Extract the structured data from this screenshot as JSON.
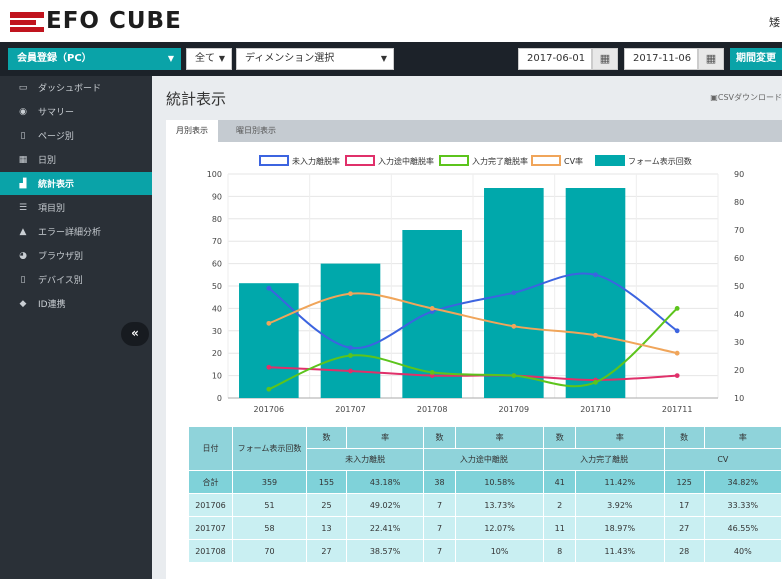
{
  "app": {
    "logo_text": "EFO CUBE",
    "user_mark": "矮"
  },
  "filters": {
    "form_select": "会員登録（PC）",
    "scope_select": "全て",
    "dimension_select": "ディメンション選択",
    "start_date": "2017-06-01",
    "end_date": "2017-11-06",
    "period_button": "期間変更"
  },
  "sidebar": {
    "items": [
      {
        "label": "ダッシュボード",
        "icon": "monitor-icon",
        "glyph": "▭",
        "active": false
      },
      {
        "label": "サマリー",
        "icon": "globe-icon",
        "glyph": "◉",
        "active": false
      },
      {
        "label": "ページ別",
        "icon": "file-icon",
        "glyph": "▯",
        "active": false
      },
      {
        "label": "日別",
        "icon": "calendar-icon",
        "glyph": "▦",
        "active": false
      },
      {
        "label": "統計表示",
        "icon": "bar-chart-icon",
        "glyph": "▟",
        "active": true
      },
      {
        "label": "項目別",
        "icon": "list-icon",
        "glyph": "☰",
        "active": false
      },
      {
        "label": "エラー詳細分析",
        "icon": "warning-icon",
        "glyph": "▲",
        "active": false
      },
      {
        "label": "ブラウザ別",
        "icon": "browser-icon",
        "glyph": "◕",
        "active": false
      },
      {
        "label": "デバイス別",
        "icon": "device-icon",
        "glyph": "▯",
        "active": false
      },
      {
        "label": "ID連携",
        "icon": "tag-icon",
        "glyph": "◆",
        "active": false
      }
    ],
    "collapse_label": "«"
  },
  "main": {
    "title": "統計表示",
    "csv_label": "CSVダウンロード",
    "tabs": [
      {
        "label": "月別表示",
        "active": true
      },
      {
        "label": "曜日別表示",
        "active": false
      }
    ]
  },
  "colors": {
    "accent": "#0aa3a8",
    "bars": "#00a8ab",
    "mi_nyuryoku": "#3c64e0",
    "nyuryoku_tochu": "#e0306a",
    "nyuryoku_kanryo": "#5cc41c",
    "cv": "#f0a55a"
  },
  "chart_data": {
    "type": "bar",
    "categories": [
      "201706",
      "201707",
      "201708",
      "201709",
      "201710",
      "201711"
    ],
    "y_left": {
      "ylim": [
        0,
        100
      ],
      "ticks": [
        0,
        10,
        20,
        30,
        40,
        50,
        60,
        70,
        80,
        90,
        100
      ]
    },
    "y_right": {
      "ylim": [
        10,
        90
      ],
      "ticks": [
        10,
        20,
        30,
        40,
        50,
        60,
        70,
        80,
        90
      ]
    },
    "legend_position": "top",
    "series": [
      {
        "name": "未入力離脱率",
        "type": "line",
        "axis": "left",
        "values": [
          49.02,
          22.41,
          38.57,
          47,
          55,
          30
        ]
      },
      {
        "name": "入力途中離脱率",
        "type": "line",
        "axis": "left",
        "values": [
          13.73,
          12.07,
          10,
          10,
          8,
          10
        ]
      },
      {
        "name": "入力完了離脱率",
        "type": "line",
        "axis": "left",
        "values": [
          3.92,
          18.97,
          11.43,
          10,
          7,
          40
        ]
      },
      {
        "name": "CV率",
        "type": "line",
        "axis": "left",
        "values": [
          33.33,
          46.55,
          40,
          32,
          28,
          20
        ]
      },
      {
        "name": "フォーム表示回数",
        "type": "bar",
        "axis": "right",
        "values": [
          51,
          58,
          70,
          85,
          85,
          null
        ]
      }
    ]
  },
  "table": {
    "header_top": [
      "日付",
      "フォーム表示回数",
      "数",
      "率",
      "数",
      "率",
      "数",
      "率",
      "数",
      "率"
    ],
    "groups": [
      "未入力離脱",
      "入力途中離脱",
      "入力完了離脱",
      "CV"
    ],
    "rows": [
      [
        "合計",
        "359",
        "155",
        "43.18%",
        "38",
        "10.58%",
        "41",
        "11.42%",
        "125",
        "34.82%"
      ],
      [
        "201706",
        "51",
        "25",
        "49.02%",
        "7",
        "13.73%",
        "2",
        "3.92%",
        "17",
        "33.33%"
      ],
      [
        "201707",
        "58",
        "13",
        "22.41%",
        "7",
        "12.07%",
        "11",
        "18.97%",
        "27",
        "46.55%"
      ],
      [
        "201708",
        "70",
        "27",
        "38.57%",
        "7",
        "10%",
        "8",
        "11.43%",
        "28",
        "40%"
      ]
    ]
  }
}
